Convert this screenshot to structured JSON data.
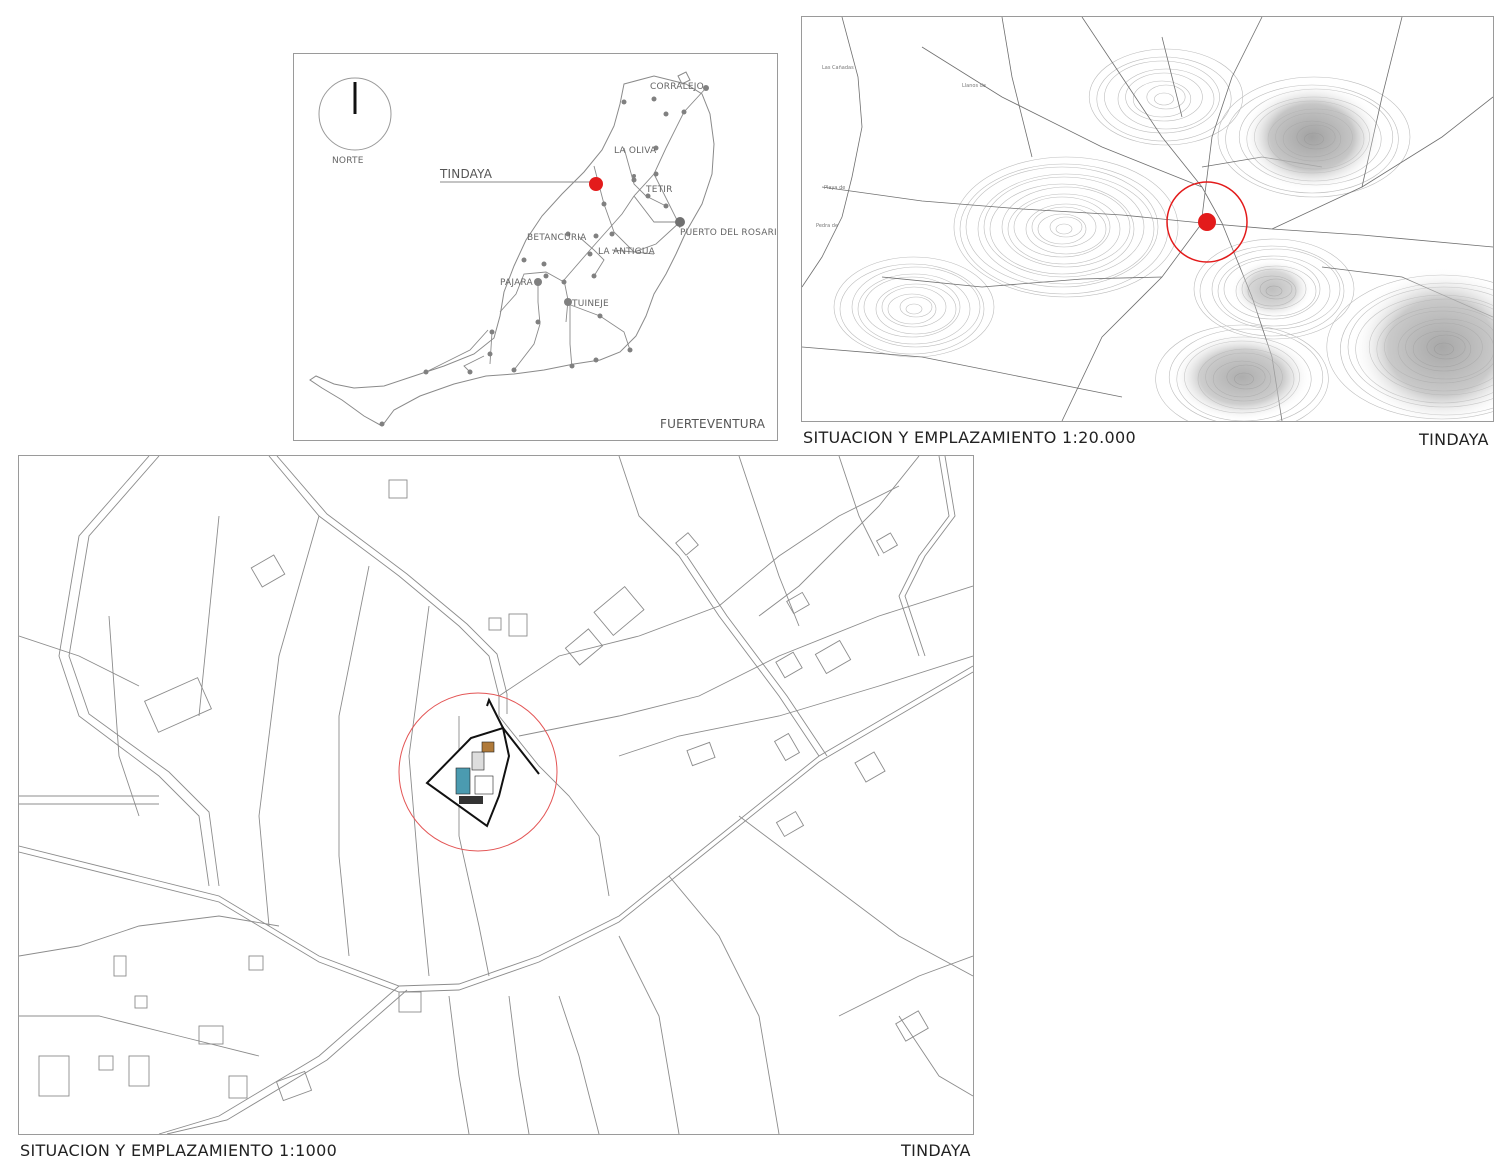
{
  "island_map": {
    "compass_label": "NORTE",
    "highlight_label": "TINDAYA",
    "island_name": "FUERTEVENTURA",
    "towns": [
      {
        "name": "CORRALEJO"
      },
      {
        "name": "LA OLIVA"
      },
      {
        "name": "TETIR"
      },
      {
        "name": "PUERTO DEL ROSARIO"
      },
      {
        "name": "BETANCURIA"
      },
      {
        "name": "LA ANTIGUA"
      },
      {
        "name": "PAJARA"
      },
      {
        "name": "TUINEJE"
      }
    ],
    "colors": {
      "highlight": "#e31b1b",
      "lines": "#8a8a8a"
    }
  },
  "regional_map": {
    "caption": "SITUACION Y EMPLAZAMIENTO   1:20.000",
    "place": "TINDAYA",
    "small_labels": [
      "Las Cañadas",
      "Playa de",
      "Pedra de",
      "Llanos de"
    ],
    "colors": {
      "marker": "#e31b1b",
      "contours": "#b5b5b5"
    }
  },
  "site_plan": {
    "caption": "SITUACION Y EMPLAZAMIENTO  1:1000",
    "place": "TINDAYA",
    "colors": {
      "circle": "#e35555",
      "building_pool": "#4b9bb0",
      "building_roof": "#b07a3a"
    }
  }
}
